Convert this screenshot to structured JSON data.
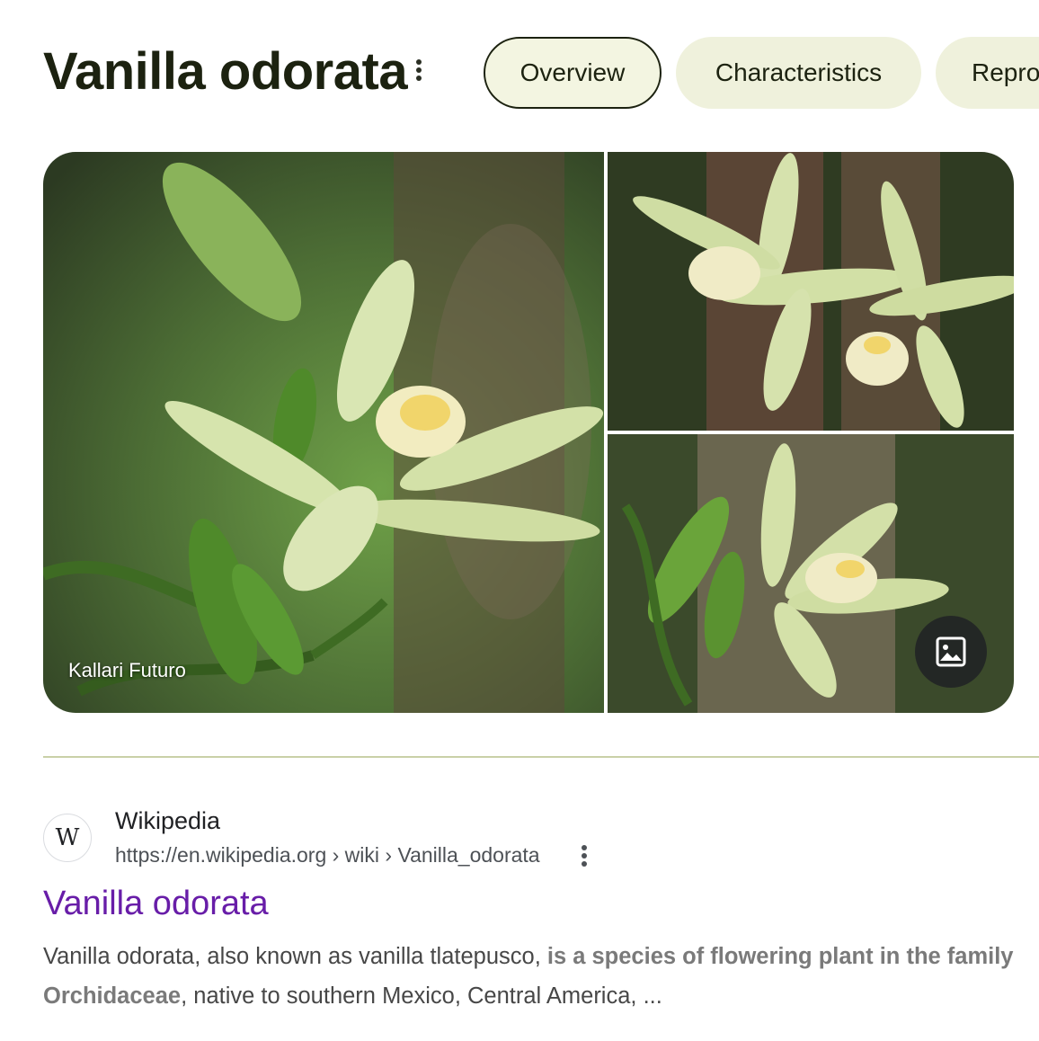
{
  "header": {
    "title": "Vanilla odorata",
    "more_icon": "more-vert-icon"
  },
  "tabs": [
    {
      "label": "Overview",
      "active": true
    },
    {
      "label": "Characteristics",
      "active": false
    },
    {
      "label": "Repro",
      "active": false
    }
  ],
  "gallery": {
    "credit": "Kallari Futuro",
    "more_images_icon": "image-icon"
  },
  "result": {
    "site_icon_letter": "W",
    "site_name": "Wikipedia",
    "url": "https://en.wikipedia.org › wiki › Vanilla_odorata",
    "title": "Vanilla odorata",
    "snippet_plain_1": "Vanilla odorata, also known as vanilla tlatepusco, ",
    "snippet_bold_1": "is a species of flowering plant in the family Orchidaceae",
    "snippet_plain_2": ", native to southern Mexico, Central America, ..."
  },
  "colors": {
    "tab_bg": "#eff1dc",
    "title": "#1c2210",
    "visited_link": "#681da8",
    "divider": "#c9d0a8"
  }
}
